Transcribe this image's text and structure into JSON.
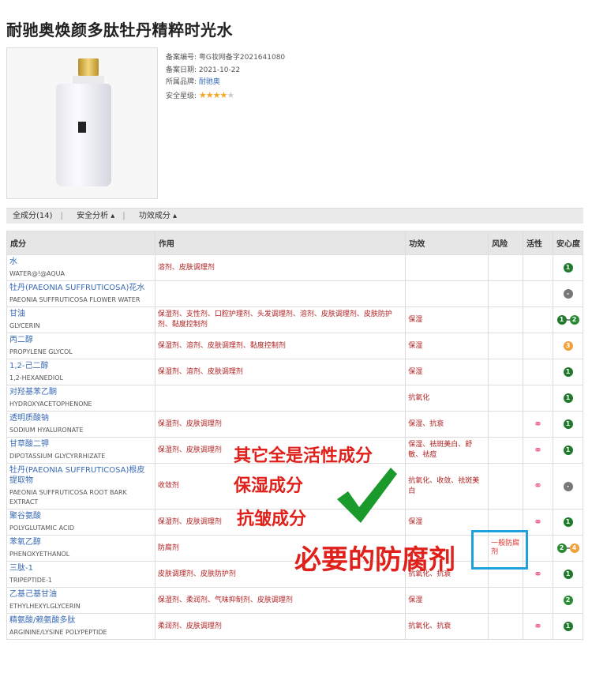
{
  "title": "耐驰奥焕颜多肽牡丹精粹时光水",
  "meta": {
    "record_no_label": "备案编号:",
    "record_no": "粤G妆网备字2021641080",
    "record_date_label": "备案日期:",
    "record_date": "2021-10-22",
    "brand_label": "所属品牌:",
    "brand": "耐驰奥",
    "safety_label": "安全星级:",
    "safety_stars": 4,
    "safety_stars_max": 5
  },
  "tabs": [
    {
      "label": "全成分(14)"
    },
    {
      "label": "安全分析 ▴"
    },
    {
      "label": "功效成分 ▴"
    }
  ],
  "table": {
    "headers": [
      "成分",
      "作用",
      "功效",
      "风险",
      "活性",
      "安心度"
    ],
    "rows": [
      {
        "cn": "水",
        "en": "WATER@!@AQUA",
        "fn": "溶剂、皮肤调理剂",
        "effect": "",
        "risk": "",
        "active": false,
        "safety": [
          "1"
        ]
      },
      {
        "cn": "牡丹(PAEONIA SUFFRUTICOSA)花水",
        "en": "PAEONIA SUFFRUTICOSA FLOWER WATER",
        "fn": "",
        "effect": "",
        "risk": "",
        "active": false,
        "safety": [
          "-"
        ]
      },
      {
        "cn": "甘油",
        "en": "GLYCERIN",
        "fn": "保湿剂、支性剂、口腔护理剂、头发调理剂、溶剂、皮肤调理剂、皮肤防护剂、黏度控制剂",
        "effect": "保湿",
        "risk": "",
        "active": false,
        "safety": [
          "1",
          "2"
        ]
      },
      {
        "cn": "丙二醇",
        "en": "PROPYLENE GLYCOL",
        "fn": "保湿剂、溶剂、皮肤调理剂、黏度控制剂",
        "effect": "保湿",
        "risk": "",
        "active": false,
        "safety": [
          "3"
        ]
      },
      {
        "cn": "1,2-己二醇",
        "en": "1,2-HEXANEDIOL",
        "fn": "保湿剂、溶剂、皮肤调理剂",
        "effect": "保湿",
        "risk": "",
        "active": false,
        "safety": [
          "1"
        ]
      },
      {
        "cn": "对羟基苯乙酮",
        "en": "HYDROXYACETOPHENONE",
        "fn": "",
        "effect": "抗氧化",
        "risk": "",
        "active": false,
        "safety": [
          "1"
        ]
      },
      {
        "cn": "透明质酸钠",
        "en": "SODIUM HYALURONATE",
        "fn": "保湿剂、皮肤调理剂",
        "effect": "保湿、抗衰",
        "risk": "",
        "active": true,
        "safety": [
          "1"
        ]
      },
      {
        "cn": "甘草酸二钾",
        "en": "DIPOTASSIUM GLYCYRRHIZATE",
        "fn": "保湿剂、皮肤调理剂",
        "effect": "保湿、祛斑美白、舒敏、祛痘",
        "risk": "",
        "active": true,
        "safety": [
          "1"
        ]
      },
      {
        "cn": "牡丹(PAEONIA SUFFRUTICOSA)根皮提取物",
        "en": "PAEONIA SUFFRUTICOSA ROOT BARK EXTRACT",
        "fn": "收敛剂",
        "effect": "抗氧化、收敛、祛斑美白",
        "risk": "",
        "active": true,
        "safety": [
          "-"
        ]
      },
      {
        "cn": "聚谷氨酸",
        "en": "POLYGLUTAMIC ACID",
        "fn": "保湿剂、皮肤调理剂",
        "effect": "保湿",
        "risk": "",
        "active": true,
        "safety": [
          "1"
        ]
      },
      {
        "cn": "苯氧乙醇",
        "en": "PHENOXYETHANOL",
        "fn": "防腐剂",
        "effect": "",
        "risk": "一般防腐剂",
        "active": false,
        "safety": [
          "2",
          "4"
        ]
      },
      {
        "cn": "三肽-1",
        "en": "TRIPEPTIDE-1",
        "fn": "皮肤调理剂、皮肤防护剂",
        "effect": "抗氧化、抗衰",
        "risk": "",
        "active": true,
        "safety": [
          "1"
        ]
      },
      {
        "cn": "乙基己基甘油",
        "en": "ETHYLHEXYLGLYCERIN",
        "fn": "保湿剂、柔润剂、气味抑制剂、皮肤调理剂",
        "effect": "保湿",
        "risk": "",
        "active": false,
        "safety": [
          "2"
        ]
      },
      {
        "cn": "精氨酸/赖氨酸多肽",
        "en": "ARGININE/LYSINE POLYPEPTIDE",
        "fn": "柔润剂、皮肤调理剂",
        "effect": "抗氧化、抗衰",
        "risk": "",
        "active": true,
        "safety": [
          "1"
        ]
      }
    ]
  },
  "annotations": {
    "line1": "其它全是活性成分",
    "line2": "保湿成分",
    "line3": "抗皱成分",
    "line4": "必要的防腐剂"
  },
  "colors": {
    "accent_blue": "#3a6bb5",
    "annotation_red": "#e0201a",
    "highlight_box": "#1ea1dd"
  }
}
